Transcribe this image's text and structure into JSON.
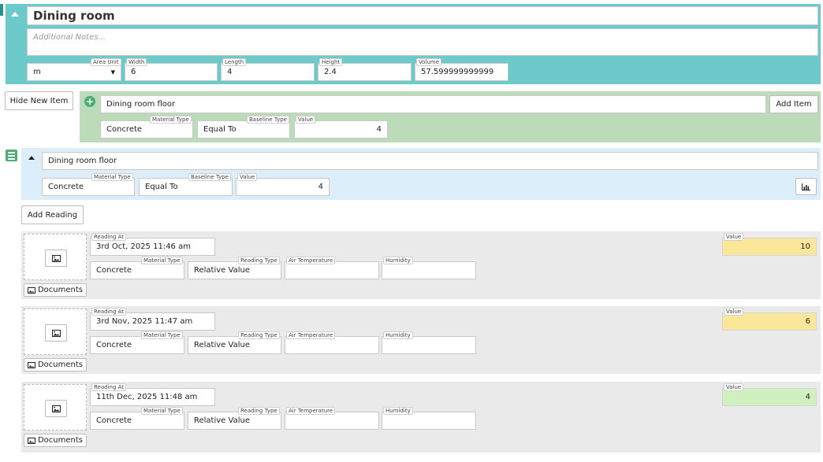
{
  "room": {
    "name": "Dining room",
    "notes_placeholder": "Additional Notes...",
    "area_unit_label": "Area Unit",
    "area_unit_value": "m",
    "width_label": "Width",
    "width_value": "6",
    "length_label": "Length",
    "length_value": "4",
    "height_label": "Height",
    "height_value": "2.4",
    "volume_label": "Volume",
    "volume_value": "57.599999999999"
  },
  "hide_new_item_label": "Hide New Item",
  "new_item": {
    "name": "Dining room floor",
    "add_item_label": "Add Item",
    "material_type_label": "Material Type",
    "material_type_value": "Concrete",
    "baseline_type_label": "Baseline Type",
    "baseline_type_value": "Equal To",
    "value_label": "Value",
    "value_value": "4"
  },
  "item": {
    "name": "Dining room floor",
    "material_type_label": "Material Type",
    "material_type_value": "Concrete",
    "baseline_type_label": "Baseline Type",
    "baseline_type_value": "Equal To",
    "value_label": "Value",
    "value_value": "4",
    "chart_icon": "bar-chart-icon"
  },
  "add_reading_label": "Add Reading",
  "labels": {
    "reading_at": "Reading At",
    "material_type": "Material Type",
    "reading_type": "Reading Type",
    "air_temperature": "Air Temperature",
    "humidity": "Humidity",
    "value": "Value",
    "documents": "Documents"
  },
  "readings": [
    {
      "reading_at": "3rd Oct, 2025 11:46 am",
      "material_type": "Concrete",
      "reading_type": "Relative Value",
      "air_temperature": "",
      "humidity": "",
      "value": "10",
      "status_color": "#fbe79a"
    },
    {
      "reading_at": "3rd Nov, 2025 11:47 am",
      "material_type": "Concrete",
      "reading_type": "Relative Value",
      "air_temperature": "",
      "humidity": "",
      "value": "6",
      "status_color": "#fbe79a"
    },
    {
      "reading_at": "11th Dec, 2025 11:48 am",
      "material_type": "Concrete",
      "reading_type": "Relative Value",
      "air_temperature": "",
      "humidity": "",
      "value": "4",
      "status_color": "#d1f0c0"
    }
  ],
  "colors": {
    "room_panel": "#6ccacb",
    "new_item_panel": "#bcdcb9",
    "item_panel": "#dbeefa",
    "reading_row": "#eaeaea",
    "accent_green": "#4cae73"
  }
}
